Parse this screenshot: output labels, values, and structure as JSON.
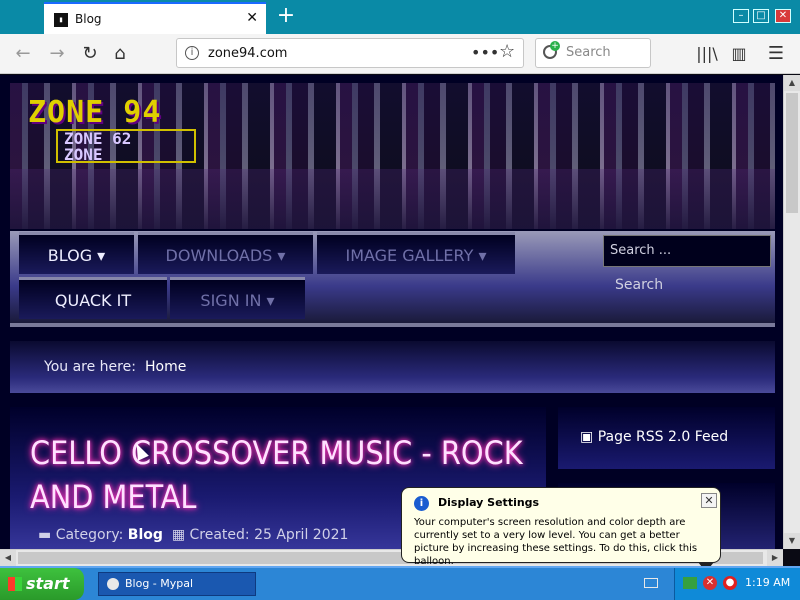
{
  "browser": {
    "tab_title": "Blog",
    "tab_favicon": "terminal-icon",
    "new_tab_symbol": "+",
    "url": "zone94.com",
    "page_actions": "•••",
    "search_placeholder": "Search"
  },
  "window_controls": {
    "minimize": "–",
    "maximize": "□",
    "close": "✕"
  },
  "site": {
    "logo_title": "ZONE 94",
    "logo_sub_line1": "ZONE 62",
    "logo_sub_line2": "ZONE",
    "nav": [
      {
        "label": "BLOG ▾"
      },
      {
        "label": "DOWNLOADS ▾"
      },
      {
        "label": "IMAGE GALLERY ▾"
      },
      {
        "label": "QUACK IT"
      },
      {
        "label": "SIGN IN ▾"
      }
    ],
    "search_placeholder": "Search ...",
    "search_button": "Search",
    "breadcrumb_label": "You are here:",
    "breadcrumb_home": "Home",
    "article_title": "CELLO CROSSOVER MUSIC - ROCK AND METAL",
    "article_category_label": "Category:",
    "article_category": "Blog",
    "article_created": "Created: 25 April 2021",
    "rss_feed": "Page RSS 2.0 Feed"
  },
  "balloon": {
    "title": "Display Settings",
    "body": "Your computer's screen resolution and color depth are currently set to a very low level. You can get a better picture by increasing these settings. To do this, click this balloon.",
    "close": "✕"
  },
  "taskbar": {
    "start_label": "start",
    "task_button": "Blog - Mypal",
    "clock": "1:19 AM"
  },
  "colors": {
    "taskbar": "#2c86d6",
    "start": "#3ec13e",
    "tab_strip": "#0a8aa6",
    "title_glow": "#ff30c0"
  }
}
